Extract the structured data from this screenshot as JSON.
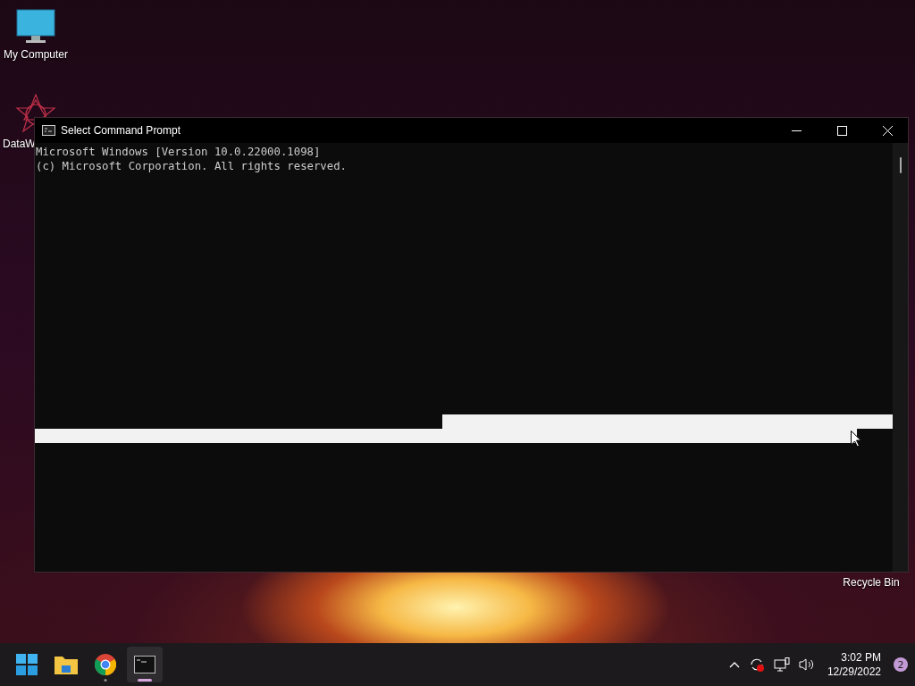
{
  "desktop_icons": [
    {
      "kind": "computer",
      "label": "My Computer"
    },
    {
      "kind": "app",
      "label": "DataW"
    },
    {
      "kind": "recycle",
      "label": "Recycle Bin"
    }
  ],
  "window": {
    "title": "Select Command Prompt",
    "lines": [
      "Microsoft Windows [Version 10.0.22000.1098]",
      "(c) Microsoft Corporation. All rights reserved."
    ]
  },
  "taskbar": {
    "apps": [
      {
        "kind": "start",
        "selected": false,
        "running": false
      },
      {
        "kind": "explorer",
        "selected": false,
        "running": false
      },
      {
        "kind": "chrome",
        "selected": false,
        "running": true
      },
      {
        "kind": "terminal",
        "selected": true,
        "running": true
      }
    ],
    "clock": {
      "time": "3:02 PM",
      "date": "12/29/2022"
    },
    "notifications": "2"
  }
}
